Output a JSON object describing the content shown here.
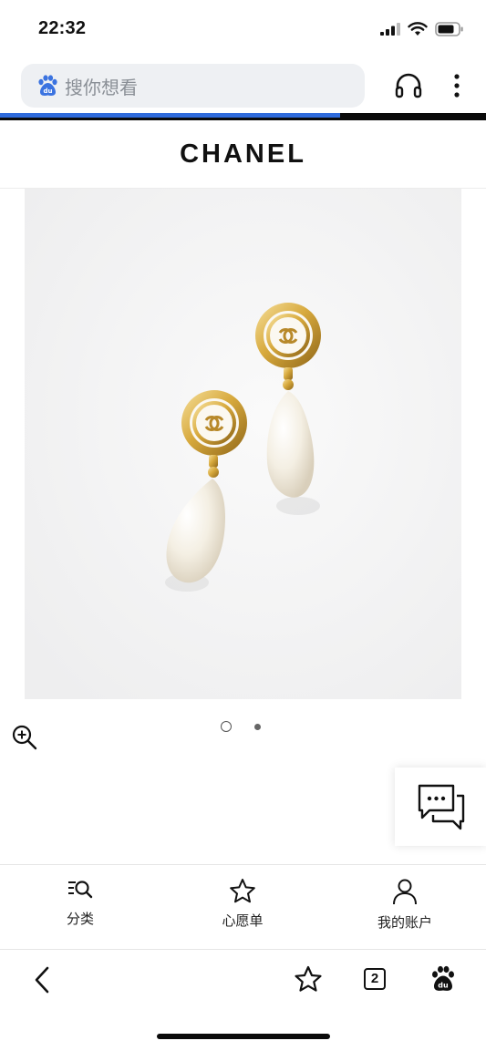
{
  "status_bar": {
    "time": "22:32"
  },
  "browser": {
    "search_placeholder": "搜你想看",
    "load_progress_percent": 70,
    "accent_color": "#2f6bdc",
    "open_tabs_count": "2"
  },
  "site": {
    "logo": "CHANEL"
  },
  "product_gallery": {
    "image_description_icon": "earrings-product-image",
    "slide_count": 2,
    "active_slide": 1
  },
  "bottom_nav": {
    "items": [
      {
        "label": "分类",
        "icon": "category-search-icon"
      },
      {
        "label": "心愿单",
        "icon": "star-icon"
      },
      {
        "label": "我的账户",
        "icon": "user-icon"
      }
    ]
  },
  "icons": {
    "zoom": "zoom-in-icon",
    "chat": "chat-icon",
    "back": "back-chevron-icon",
    "bookmark": "star-icon",
    "baidu": "baidu-paw-icon"
  }
}
